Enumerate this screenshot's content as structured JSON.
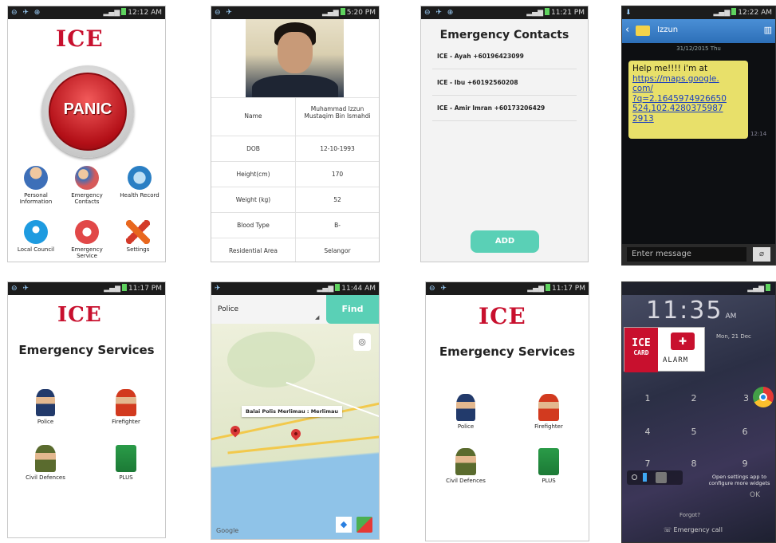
{
  "colors": {
    "ice_red": "#c8102e",
    "teal": "#5ad0b6",
    "panic_red": "#d7181f",
    "sms_yellow": "#e8e06a",
    "map_water": "#8fc3e8",
    "map_land": "#e9ecd8"
  },
  "screens": {
    "home": {
      "status": {
        "time": "12:12 AM"
      },
      "logo": "ICE",
      "panic_label": "PANIC",
      "menu": [
        {
          "label": "Personal Information",
          "icon": "person-info-icon"
        },
        {
          "label": "Emergency Contacts",
          "icon": "contacts-icon"
        },
        {
          "label": "Health Record",
          "icon": "health-record-icon"
        },
        {
          "label": "Local Council",
          "icon": "location-pin-icon"
        },
        {
          "label": "Emergency Service",
          "icon": "phone-24-icon"
        },
        {
          "label": "Settings",
          "icon": "tools-icon"
        }
      ]
    },
    "profile": {
      "status": {
        "time": "5:20 PM"
      },
      "rows": [
        {
          "key": "Name",
          "value": "Muhammad Izzun Mustaqim Bin Ismahdi"
        },
        {
          "key": "DOB",
          "value": "12-10-1993"
        },
        {
          "key": "Height(cm)",
          "value": "170"
        },
        {
          "key": "Weight (kg)",
          "value": "52"
        },
        {
          "key": "Blood Type",
          "value": "B-"
        },
        {
          "key": "Residential Area",
          "value": "Selangor"
        }
      ]
    },
    "contacts": {
      "status": {
        "time": "11:21 PM"
      },
      "title": "Emergency Contacts",
      "items": [
        "ICE - Ayah +60196423099",
        "ICE - Ibu +60192560208",
        "ICE - Amir Imran +60173206429"
      ],
      "add_label": "ADD"
    },
    "sms": {
      "status": {
        "time": "12:22 AM"
      },
      "contact_name": "Izzun",
      "date_line": "31/12/2015 Thu",
      "message_lines": [
        "Help me!!!! i'm at",
        "https://maps.google.",
        "com/",
        "?q=2.1645974926650",
        "524,102.4280375987",
        "2913"
      ],
      "time_stamp": "12:14",
      "input_placeholder": "Enter message"
    },
    "services1": {
      "status": {
        "time": "11:17 PM"
      },
      "logo": "ICE",
      "title": "Emergency Services",
      "services": [
        {
          "label": "Police",
          "icon": "police-icon"
        },
        {
          "label": "Firefighter",
          "icon": "firefighter-icon"
        },
        {
          "label": "Civil Defences",
          "icon": "civil-defence-icon"
        },
        {
          "label": "PLUS",
          "icon": "plus-highway-icon"
        }
      ]
    },
    "map": {
      "status": {
        "time": "11:44 AM"
      },
      "dropdown_value": "Police",
      "find_label": "Find",
      "place_label": "Balai Polis Merlimau : Merlimau",
      "watermark": "Google"
    },
    "services2": {
      "status": {
        "time": "11:17 PM"
      },
      "logo": "ICE",
      "title": "Emergency Services",
      "services": [
        {
          "label": "Police",
          "icon": "police-icon"
        },
        {
          "label": "Firefighter",
          "icon": "firefighter-icon"
        },
        {
          "label": "Civil Defences",
          "icon": "civil-defence-icon"
        },
        {
          "label": "PLUS",
          "icon": "plus-highway-icon"
        }
      ]
    },
    "lock": {
      "clock": "11:35",
      "ampm": "AM",
      "date": "Mon, 21 Dec",
      "widget_ice_top": "ICE",
      "widget_ice_bottom": "CARD",
      "widget_alarm": "ALARM",
      "widget_hint": "Open settings app to configure more widgets",
      "keys": [
        "1",
        "2",
        "3",
        "4",
        "5",
        "6",
        "7",
        "8",
        "9"
      ],
      "ok_label": "OK",
      "forgot_label": "Forgot?",
      "emergency_call": "Emergency call"
    }
  }
}
